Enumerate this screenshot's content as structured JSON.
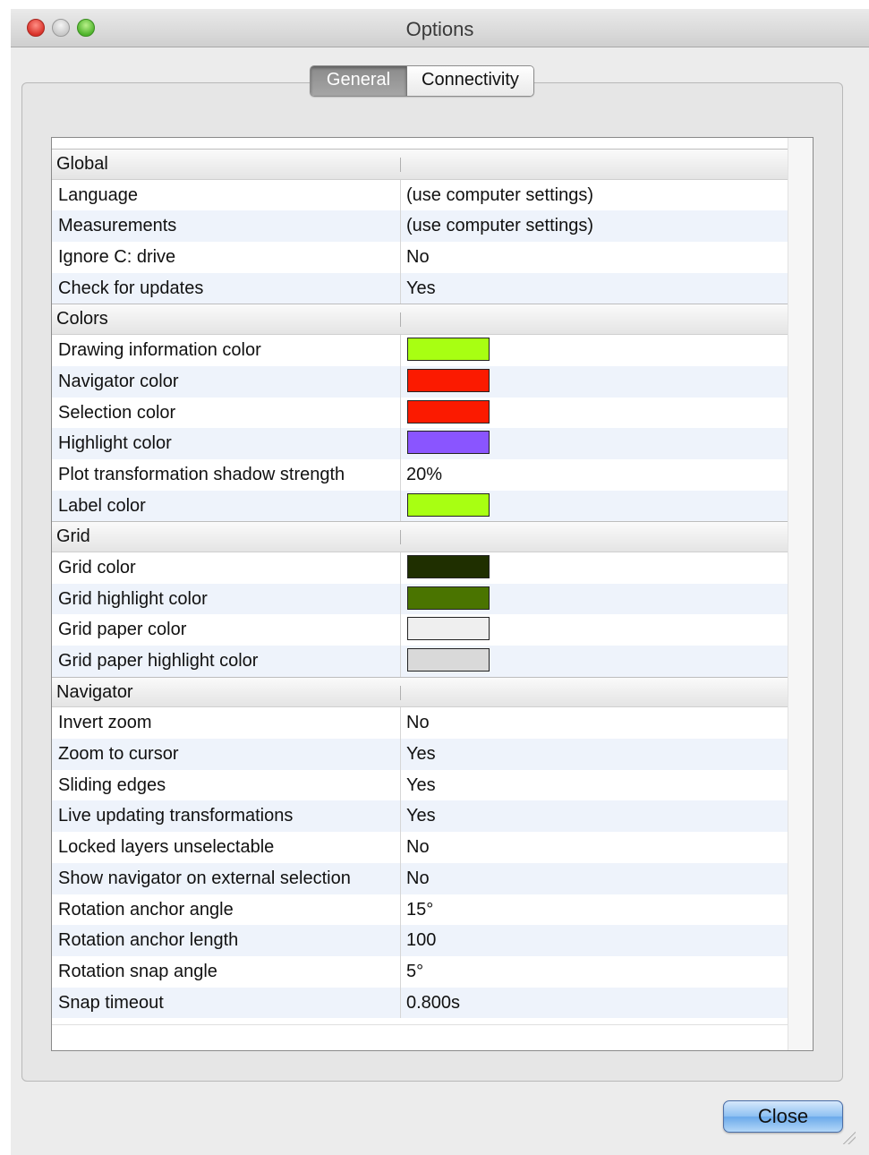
{
  "window": {
    "title": "Options"
  },
  "tabs": [
    {
      "label": "General",
      "active": true
    },
    {
      "label": "Connectivity",
      "active": false
    }
  ],
  "sections": [
    {
      "title": "Global",
      "rows": [
        {
          "label": "Language",
          "value": "(use computer settings)"
        },
        {
          "label": "Measurements",
          "value": "(use computer settings)"
        },
        {
          "label": "Ignore C: drive",
          "value": "No"
        },
        {
          "label": "Check for updates",
          "value": "Yes"
        }
      ]
    },
    {
      "title": "Colors",
      "rows": [
        {
          "label": "Drawing information color",
          "color": "#a8ff12"
        },
        {
          "label": "Navigator color",
          "color": "#fb1a00"
        },
        {
          "label": "Selection color",
          "color": "#fb1a00"
        },
        {
          "label": "Highlight color",
          "color": "#8a55ff"
        },
        {
          "label": "Plot transformation shadow strength",
          "value": "20%"
        },
        {
          "label": "Label color",
          "color": "#a8ff12"
        }
      ]
    },
    {
      "title": "Grid",
      "rows": [
        {
          "label": "Grid color",
          "color": "#1f2f00"
        },
        {
          "label": "Grid highlight color",
          "color": "#4a7400"
        },
        {
          "label": "Grid paper color",
          "color": "#efefef"
        },
        {
          "label": "Grid paper highlight color",
          "color": "#d9d9d9"
        }
      ]
    },
    {
      "title": "Navigator",
      "rows": [
        {
          "label": "Invert zoom",
          "value": "No"
        },
        {
          "label": "Zoom to cursor",
          "value": "Yes"
        },
        {
          "label": "Sliding edges",
          "value": "Yes"
        },
        {
          "label": "Live updating transformations",
          "value": "Yes"
        },
        {
          "label": "Locked layers unselectable",
          "value": "No"
        },
        {
          "label": "Show navigator on external selection",
          "value": "No"
        },
        {
          "label": "Rotation anchor angle",
          "value": "15°"
        },
        {
          "label": "Rotation anchor length",
          "value": "100"
        },
        {
          "label": "Rotation snap angle",
          "value": "5°"
        },
        {
          "label": "Snap timeout",
          "value": "0.800s"
        }
      ]
    }
  ],
  "buttons": {
    "close_label": "Close"
  }
}
